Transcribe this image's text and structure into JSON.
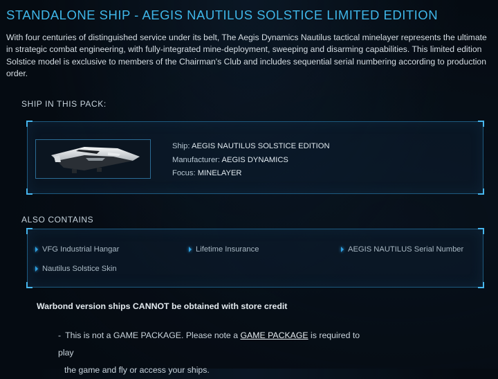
{
  "header": {
    "title": "STANDALONE SHIP - AEGIS NAUTILUS SOLSTICE LIMITED EDITION",
    "description": "With four centuries of distinguished service under its belt, The Aegis Dynamics Nautilus tactical minelayer represents the ultimate in strategic combat engineering, with fully-integrated mine-deployment, sweeping and disarming capabilities. This limited edition Solstice model is exclusive to members of the Chairman's Club and includes sequential serial numbering according to production order."
  },
  "ship_section": {
    "label": "SHIP IN THIS PACK:",
    "ship_label": "Ship:",
    "ship_value": "AEGIS NAUTILUS SOLSTICE EDITION",
    "manufacturer_label": "Manufacturer:",
    "manufacturer_value": "AEGIS DYNAMICS",
    "focus_label": "Focus:",
    "focus_value": "MINELAYER",
    "thumbnail_icon": "ship-image"
  },
  "also_contains": {
    "label": "ALSO CONTAINS",
    "items": [
      "VFG Industrial Hangar",
      "Lifetime Insurance",
      "AEGIS NAUTILUS Serial Number",
      "Nautilus Solstice Skin"
    ]
  },
  "notes": {
    "warbond": "Warbond version ships CANNOT be obtained with store credit",
    "game_package_prefix": "This is not a GAME PACKAGE. Please note a",
    "game_package_link": "GAME PACKAGE",
    "game_package_suffix": "is required to play",
    "game_package_cont": "the game and fly or access your ships."
  },
  "colors": {
    "accent": "#3fb6e8",
    "frame_border": "#1d5a80",
    "background": "#050b12"
  }
}
